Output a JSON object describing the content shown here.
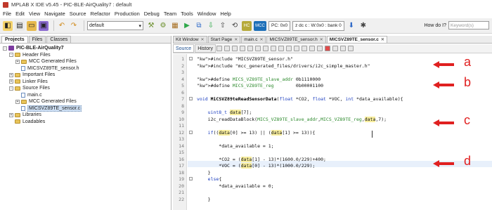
{
  "window": {
    "title": "MPLAB X IDE v5.45 - PIC-BLE-AirQuality7 : default"
  },
  "menu": [
    "File",
    "Edit",
    "View",
    "Navigate",
    "Source",
    "Refactor",
    "Production",
    "Debug",
    "Team",
    "Tools",
    "Window",
    "Help"
  ],
  "toolbar": {
    "config": "default",
    "pc": "PC: 0x0",
    "status": "z dc c : W:0x0 : bank 0",
    "howdoi_label": "How do I?",
    "howdoi_placeholder": "Keyword(s)"
  },
  "left_tabs": [
    "Projects",
    "Files",
    "Classes"
  ],
  "tree": [
    {
      "label": "PIC-BLE-AirQuality7",
      "level": 0,
      "type": "project",
      "toggle": "-"
    },
    {
      "label": "Header Files",
      "level": 1,
      "type": "folder",
      "toggle": "-"
    },
    {
      "label": "MCC Generated Files",
      "level": 2,
      "type": "folder",
      "toggle": "+"
    },
    {
      "label": "MICSVZ89TE_sensor.h",
      "level": 2,
      "type": "file",
      "toggle": ""
    },
    {
      "label": "Important Files",
      "level": 1,
      "type": "folder",
      "toggle": "+"
    },
    {
      "label": "Linker Files",
      "level": 1,
      "type": "folder",
      "toggle": "+"
    },
    {
      "label": "Source Files",
      "level": 1,
      "type": "folder",
      "toggle": "-"
    },
    {
      "label": "main.c",
      "level": 2,
      "type": "file",
      "toggle": ""
    },
    {
      "label": "MCC Generated Files",
      "level": 2,
      "type": "folder",
      "toggle": "+"
    },
    {
      "label": "MICSVZ89TE_sensor.c",
      "level": 2,
      "type": "file",
      "toggle": "",
      "selected": true
    },
    {
      "label": "Libraries",
      "level": 1,
      "type": "folder",
      "toggle": "+"
    },
    {
      "label": "Loadables",
      "level": 1,
      "type": "folder",
      "toggle": ""
    }
  ],
  "editor_tabs": [
    {
      "label": "Kit Window",
      "active": false
    },
    {
      "label": "Start Page",
      "active": false
    },
    {
      "label": "main.c",
      "active": false
    },
    {
      "label": "MICSVZ89TE_sensor.h",
      "active": false
    },
    {
      "label": "MICSVZ89TE_sensor.c",
      "active": true
    }
  ],
  "view_tabs": [
    "Source",
    "History"
  ],
  "code_lines": [
    {
      "n": "1",
      "text": "#include \"MICSVZ89TE_sensor.h\""
    },
    {
      "n": "2",
      "text": "#include \"mcc_generated_files/drivers/i2c_simple_master.h\""
    },
    {
      "n": "3",
      "text": ""
    },
    {
      "n": "4",
      "text": "#define MICS_VZ89TE_slave_addr 0b1110000"
    },
    {
      "n": "5",
      "text": "#define MICS_VZ89TE_reg        0b00001100"
    },
    {
      "n": "6",
      "text": ""
    },
    {
      "n": "7",
      "text": "void MiCSVZ89teReadSensorData(float *CO2, float *VOC, int *data_available){"
    },
    {
      "n": "8",
      "text": ""
    },
    {
      "n": "9",
      "text": "    uint8_t data[7];"
    },
    {
      "n": "10",
      "text": "    i2c_readDataBlock(MICS_VZ89TE_slave_addr,MICS_VZ89TE_reg,data,7);"
    },
    {
      "n": "11",
      "text": ""
    },
    {
      "n": "12",
      "text": "    if((data[0] >= 13) || (data[1] >= 13)){"
    },
    {
      "n": "13",
      "text": ""
    },
    {
      "n": "14",
      "text": "        *data_available = 1;"
    },
    {
      "n": "15",
      "text": ""
    },
    {
      "n": "16",
      "text": "        *CO2 = (data[1] - 13)*(1600.0/229)+400;"
    },
    {
      "n": "17",
      "text": "        *VOC = (data[0] - 13)*(1000.0/229);"
    },
    {
      "n": "18",
      "text": "    }"
    },
    {
      "n": "19",
      "text": "    else{"
    },
    {
      "n": "20",
      "text": "        *data_available = 0;"
    },
    {
      "n": "21",
      "text": ""
    },
    {
      "n": "22",
      "text": "    }"
    }
  ],
  "annotations": [
    "a",
    "b",
    "c",
    "d"
  ],
  "colors": {
    "arrow": "#e02020",
    "macro": "#2d8a2d",
    "string": "#c06000",
    "keyword": "#1a3cbf",
    "highlight": "#f8ee9e"
  }
}
